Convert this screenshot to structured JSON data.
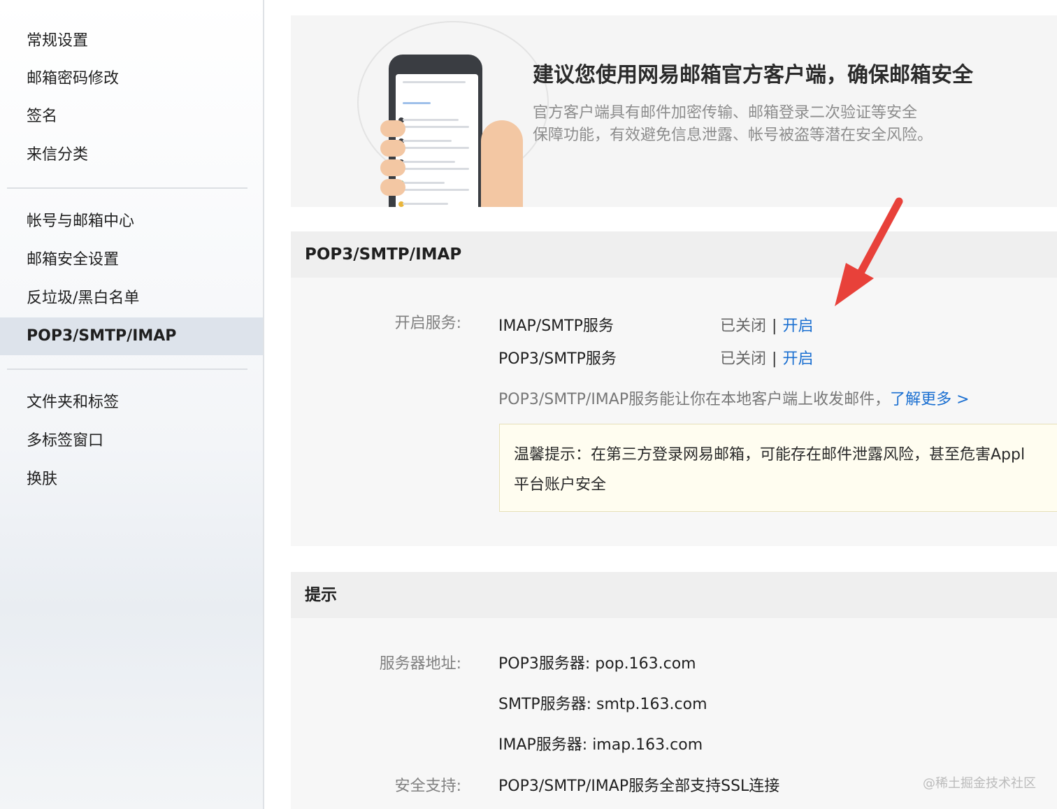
{
  "sidebar": {
    "group1": [
      {
        "label": "常规设置"
      },
      {
        "label": "邮箱密码修改"
      },
      {
        "label": "签名"
      },
      {
        "label": "来信分类"
      }
    ],
    "group2": [
      {
        "label": "帐号与邮箱中心"
      },
      {
        "label": "邮箱安全设置"
      },
      {
        "label": "反垃圾/黑白名单"
      },
      {
        "label": "POP3/SMTP/IMAP",
        "active": true
      }
    ],
    "group3": [
      {
        "label": "文件夹和标签"
      },
      {
        "label": "多标签窗口"
      },
      {
        "label": "换肤"
      }
    ]
  },
  "banner": {
    "title": "建议您使用网易邮箱官方客户端，确保邮箱安全",
    "desc_line1": "官方客户端具有邮件加密传输、邮箱登录二次验证等安全",
    "desc_line2": "保障功能，有效避免信息泄露、帐号被盗等潜在安全风险。"
  },
  "pop_panel": {
    "title": "POP3/SMTP/IMAP",
    "service_label": "开启服务:",
    "services": [
      {
        "name": "IMAP/SMTP服务",
        "status": "已关闭",
        "separator": "|",
        "action": "开启"
      },
      {
        "name": "POP3/SMTP服务",
        "status": "已关闭",
        "separator": "|",
        "action": "开启"
      }
    ],
    "intro_text": "POP3/SMTP/IMAP服务能让你在本地客户端上收发邮件，",
    "learn_more": "了解更多 >",
    "tip_line1": "温馨提示：在第三方登录网易邮箱，可能存在邮件泄露风险，甚至危害Appl",
    "tip_line2": "平台账户安全"
  },
  "hint_panel": {
    "title": "提示",
    "server_label": "服务器地址:",
    "pop3": "POP3服务器: pop.163.com",
    "smtp": "SMTP服务器: smtp.163.com",
    "imap": "IMAP服务器: imap.163.com",
    "security_label": "安全支持:",
    "security_value": "POP3/SMTP/IMAP服务全部支持SSL连接"
  },
  "watermark": "@稀土掘金技术社区",
  "colors": {
    "link": "#1a6fd1",
    "arrow": "#e8413a",
    "sidebar_active": "#dde3eb",
    "tip_background": "#fffdf0"
  }
}
